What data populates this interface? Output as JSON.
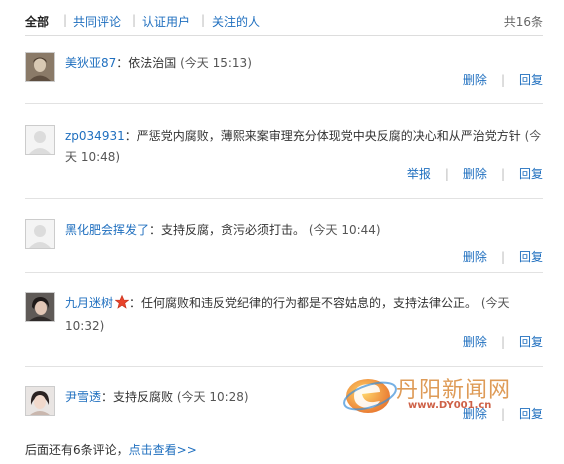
{
  "tabs": {
    "all": "全部",
    "common": "共同评论",
    "verified": "认证用户",
    "following": "关注的人",
    "separator": "|",
    "total": "共16条"
  },
  "comments": [
    {
      "user": "美狄亚87",
      "text": "：依法治国 ",
      "time": "(今天 15:13)",
      "actions": [
        "删除",
        "回复"
      ]
    },
    {
      "user": "zp034931",
      "text": "：严惩党内腐败，薄熙来案审理充分体现党中央反腐的决心和从严治党方针 ",
      "time": "(今天 10:48)",
      "actions": [
        "举报",
        "删除",
        "回复"
      ]
    },
    {
      "user": "黑化肥会挥发了",
      "text": "：支持反腐，贪污必须打击。 ",
      "time": "(今天 10:44)",
      "actions": [
        "删除",
        "回复"
      ]
    },
    {
      "user": "九月迷树",
      "badge_icon": "star-badge-icon",
      "text": "：任何腐败和违反党纪律的行为都是不容姑息的，支持法律公正。 ",
      "time": "(今天 10:32)",
      "actions": [
        "删除",
        "回复"
      ]
    },
    {
      "user": "尹雪透",
      "text": "：支持反腐败 ",
      "time": "(今天 10:28)",
      "actions": [
        "删除",
        "回复"
      ]
    }
  ],
  "more": {
    "text": "后面还有6条评论，",
    "link": "点击查看>>"
  },
  "watermark": {
    "logo_text": "丹阳新闻网",
    "url": "www.DY001.cn"
  },
  "colors": {
    "link": "#1f6fbf",
    "badge": "#e8432a",
    "watermark": "#d98a3a"
  }
}
